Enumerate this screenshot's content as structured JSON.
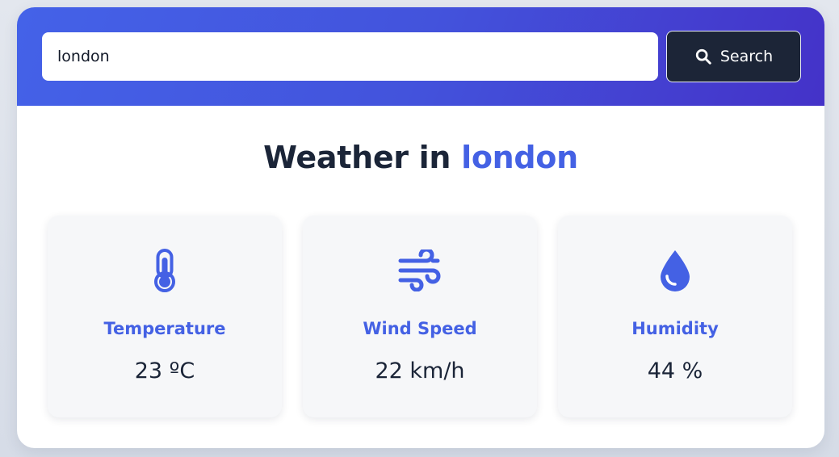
{
  "search": {
    "value": "london",
    "button_label": "Search",
    "button_icon": "search-icon"
  },
  "heading": {
    "prefix": "Weather in ",
    "city": "london"
  },
  "stats": [
    {
      "icon": "thermometer-icon",
      "label": "Temperature",
      "value": "23 ºC"
    },
    {
      "icon": "wind-icon",
      "label": "Wind Speed",
      "value": "22 km/h"
    },
    {
      "icon": "water-drop-icon",
      "label": "Humidity",
      "value": "44 %"
    }
  ],
  "colors": {
    "accent": "#4461e4",
    "header_gradient_start": "#4462e8",
    "header_gradient_end": "#4432c8",
    "button_bg": "#1c2537",
    "text_dark": "#1b2538",
    "card_bg": "#f6f7f9"
  }
}
